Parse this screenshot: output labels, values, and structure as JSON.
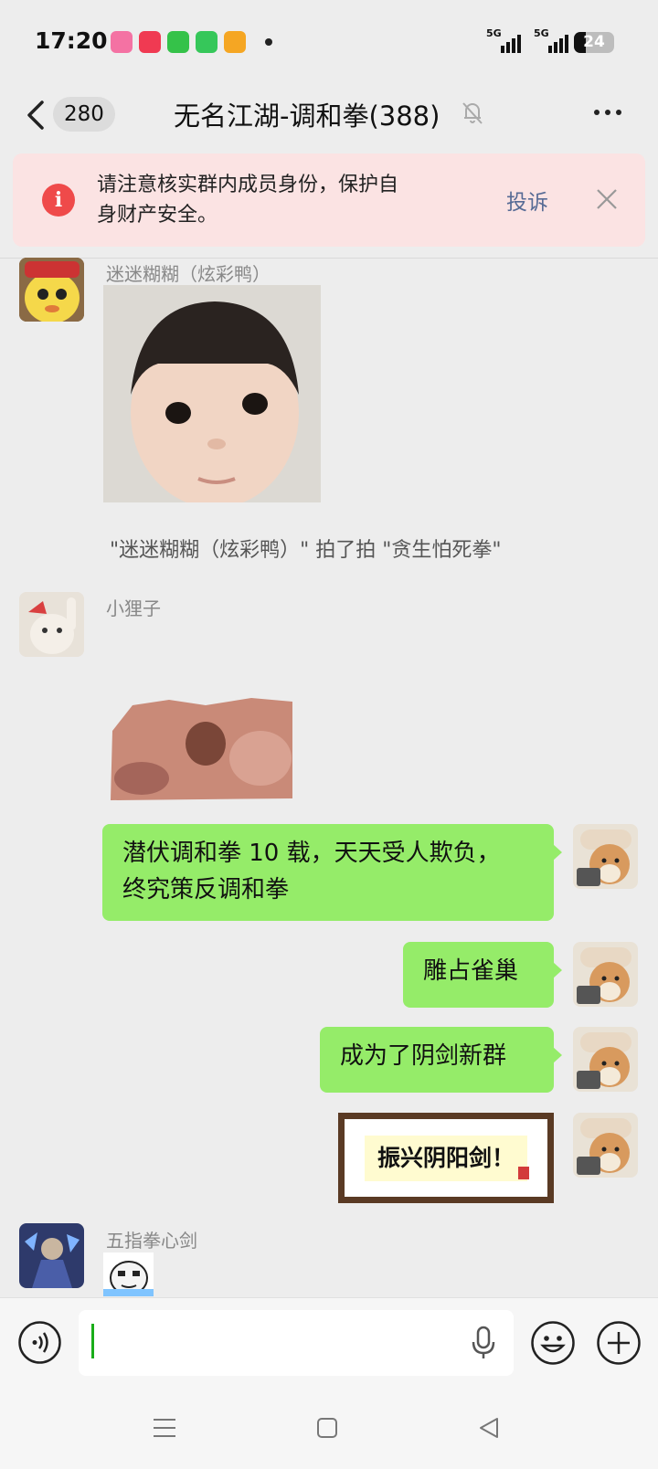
{
  "status_bar": {
    "time": "17:20",
    "battery": "24",
    "network_1": "5G",
    "network_2": "5G"
  },
  "header": {
    "unread_count": "280",
    "title": "无名江湖-调和拳(388)"
  },
  "warning": {
    "text": "请注意核实群内成员身份，保护自身财产安全。",
    "action": "投诉"
  },
  "messages": [
    {
      "sender": "迷迷糊糊（炫彩鸭）",
      "type": "image"
    },
    {
      "type": "system",
      "text": "\"迷迷糊糊（炫彩鸭）\" 拍了拍 \"贪生怕死拳\""
    },
    {
      "sender": "小狸子",
      "type": "sticker"
    },
    {
      "type": "self_text",
      "text_line1": "潜伏调和拳 10 载，天天受人欺负，",
      "text_line2": "终究策反调和拳"
    },
    {
      "type": "self_text",
      "text": "雕占雀巢"
    },
    {
      "type": "self_text",
      "text": "成为了阴剑新群"
    },
    {
      "type": "self_sticker",
      "text": "振兴阴阳剑！"
    },
    {
      "sender": "五指拳心剑",
      "type": "sticker"
    }
  ],
  "colors": {
    "bubble_green": "#95ec69",
    "warning_bg": "#fbe3e3",
    "warning_icon": "#ef4a4a",
    "link_blue": "#576b95",
    "background": "#ededed"
  }
}
